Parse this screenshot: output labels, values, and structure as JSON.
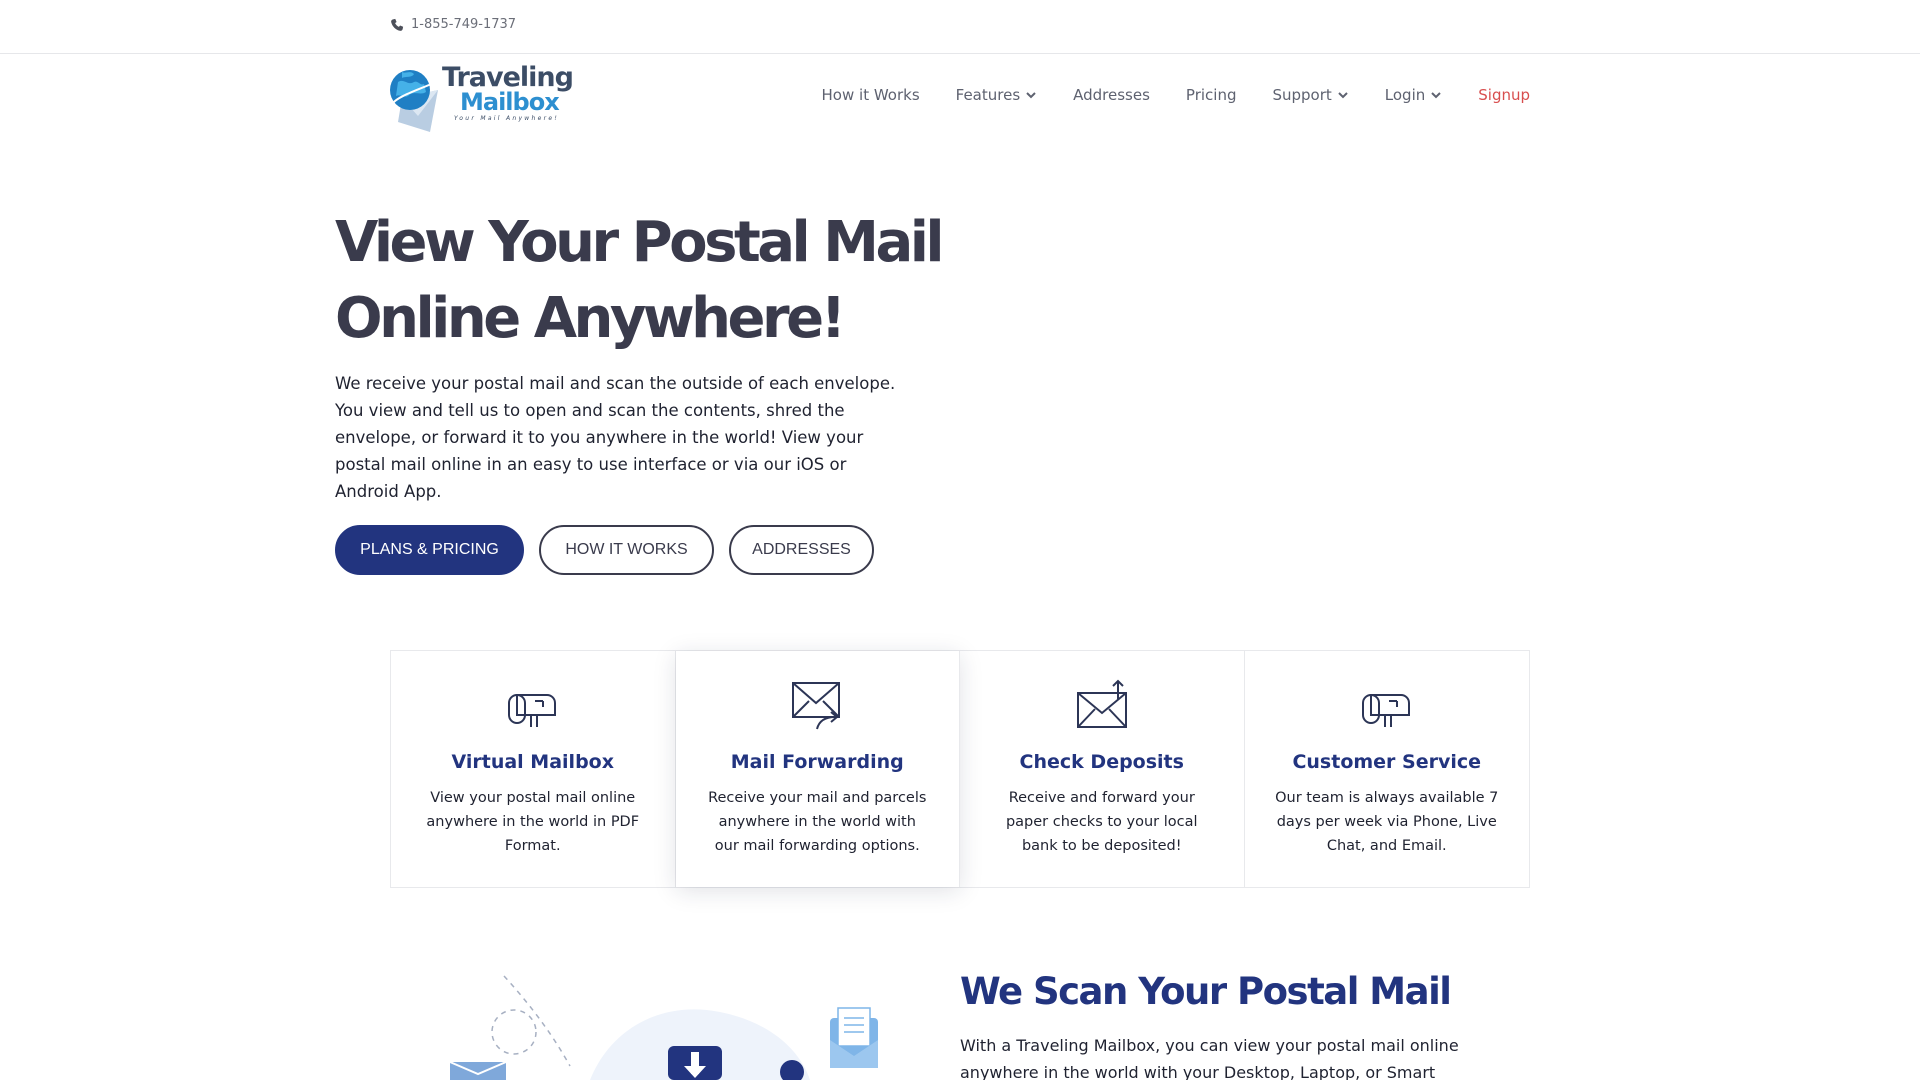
{
  "topbar": {
    "phone": "1-855-749-1737",
    "phone_icon": "phone-icon"
  },
  "logo": {
    "word1": "Traveling",
    "word2": "Mailbox",
    "tagline": "Your Mail Anywhere!",
    "icon": "globe-envelope-logo"
  },
  "nav": {
    "items": [
      {
        "label": "How it Works",
        "dropdown": false
      },
      {
        "label": "Features",
        "dropdown": true
      },
      {
        "label": "Addresses",
        "dropdown": false
      },
      {
        "label": "Pricing",
        "dropdown": false
      },
      {
        "label": "Support",
        "dropdown": true
      },
      {
        "label": "Login",
        "dropdown": true
      },
      {
        "label": "Signup",
        "dropdown": false
      }
    ],
    "signup_color": "#d84e4e"
  },
  "hero": {
    "title_line1": "View Your Postal Mail",
    "title_line2": "Online Anywhere!",
    "text": "We receive your postal mail and scan the outside of each envelope. You view and tell us to open and scan the contents, shred the envelope, or forward it to you anywhere in the world! View your postal mail online in an easy to use interface or via our iOS or Android App.",
    "buttons": {
      "primary": "PLANS & PRICING",
      "how": "HOW IT WORKS",
      "addresses": "ADDRESSES"
    },
    "primary_color": "#22347f"
  },
  "features": [
    {
      "icon": "mailbox-icon",
      "title": "Virtual Mailbox",
      "text": "View your postal mail online anywhere in the world in PDF Format."
    },
    {
      "icon": "mail-forward-icon",
      "title": "Mail Forwarding",
      "text": "Receive your mail and parcels anywhere in the world with our mail forwarding options."
    },
    {
      "icon": "check-deposit-icon",
      "title": "Check Deposits",
      "text": "Receive and forward your paper checks to your local bank to be deposited!"
    },
    {
      "icon": "mailbox-icon",
      "title": "Customer Service",
      "text": "Our team is always available 7 days per week via Phone, Live Chat, and Email."
    }
  ],
  "scan": {
    "title": "We Scan Your Postal Mail",
    "text": "With a Traveling Mailbox, you can view your postal mail online anywhere in the world with your Desktop, Laptop, or Smart",
    "illustration": "mail-scanning-illustration"
  },
  "colors": {
    "brand_navy": "#22347f",
    "heading_dark": "#3a3b4c",
    "accent_red": "#d84e4e"
  }
}
